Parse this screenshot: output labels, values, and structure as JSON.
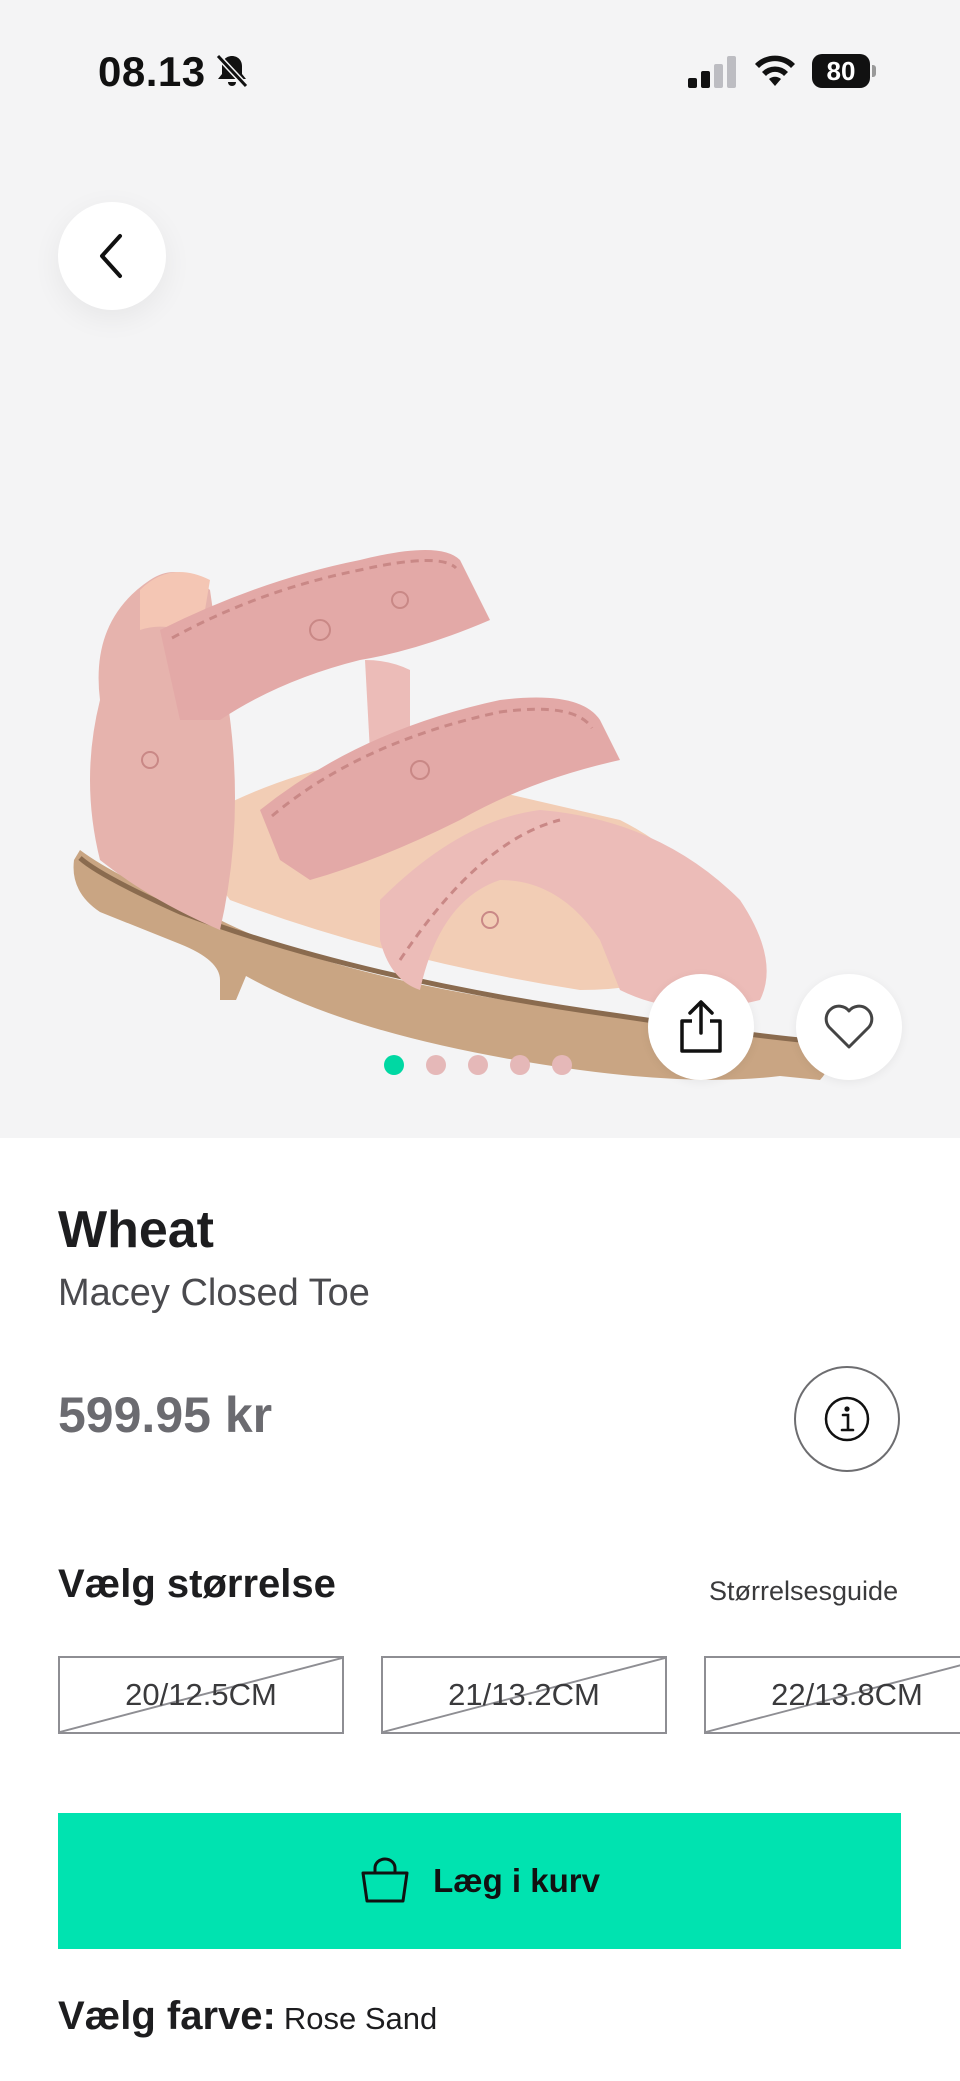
{
  "status_bar": {
    "time": "08.13",
    "battery": "80"
  },
  "carousel": {
    "count": 5,
    "active_index": 0,
    "active_color": "#00d8a3",
    "inactive_color": "#e5b8b8"
  },
  "product": {
    "brand": "Wheat",
    "name": "Macey Closed Toe",
    "price": "599.95 kr"
  },
  "sizes": {
    "heading": "Vælg størrelse",
    "guide_label": "Størrelsesguide",
    "options": [
      {
        "label": "20/12.5CM",
        "available": false
      },
      {
        "label": "21/13.2CM",
        "available": false
      },
      {
        "label": "22/13.8CM",
        "available": false
      }
    ]
  },
  "cart": {
    "button_label": "Læg i kurv",
    "accent_color": "#00e3b0"
  },
  "color": {
    "label": "Vælg farve:",
    "value": "Rose Sand"
  },
  "icons": {
    "back": "chevron-left-icon",
    "share": "share-icon",
    "favorite": "heart-icon",
    "info": "info-icon",
    "cart": "shopping-bag-icon",
    "mute": "bell-slash-icon"
  }
}
